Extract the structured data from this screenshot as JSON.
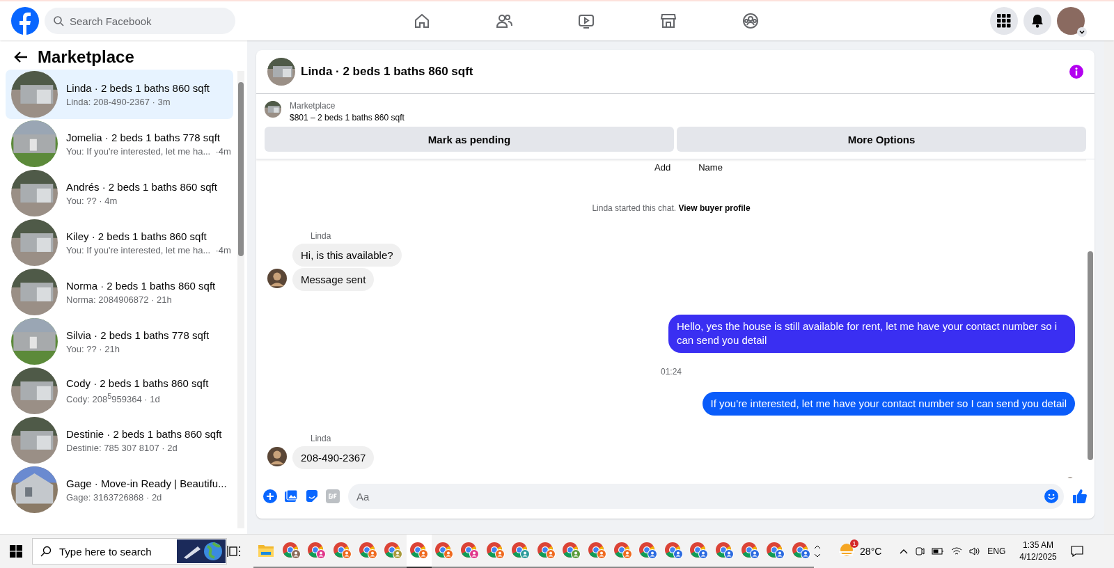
{
  "top_bar": {
    "search": {
      "placeholder": "Search Facebook"
    },
    "nav": [
      {
        "kind": "home"
      },
      {
        "kind": "friends"
      },
      {
        "kind": "video"
      },
      {
        "kind": "store"
      },
      {
        "kind": "groups"
      }
    ]
  },
  "sidebar": {
    "title": "Marketplace",
    "conversations": [
      {
        "title": "Linda · 2 beds 1 baths 860 sqft",
        "preview": "Linda: 208-490-2367 · 3m",
        "kind": "garage",
        "selected": true
      },
      {
        "title": "Jomelia · 2 beds 1 baths 778 sqft",
        "preview": "You: If you're interested, let me ha...  ·4m",
        "kind": "house",
        "selected": false
      },
      {
        "title": "Andrés · 2 beds 1 baths 860 sqft",
        "preview": "You: ?? · 4m",
        "kind": "garage",
        "selected": false
      },
      {
        "title": "Kiley · 2 beds 1 baths 860 sqft",
        "preview": "You: If you're interested, let me ha...  ·4m",
        "kind": "garage",
        "selected": false
      },
      {
        "title": "Norma · 2 beds 1 baths 860 sqft",
        "preview": "Norma: 2084906872 · 21h",
        "kind": "garage",
        "selected": false
      },
      {
        "title": "Silvia · 2 beds 1 baths 778 sqft",
        "preview": "You: ?? · 21h",
        "kind": "house",
        "selected": false
      },
      {
        "title": "Cody · 2 beds 1 baths 860 sqft",
        "preview": "Cody: 208$^{5}$959364 · 1d",
        "kind": "garage",
        "selected": false
      },
      {
        "title": "Destinie · 2 beds 1 baths 860 sqft",
        "preview": "Destinie: 785 307 8107 · 2d",
        "kind": "garage",
        "selected": false
      },
      {
        "title": "Gage · Move-in Ready | Beautifu...",
        "preview": "Gage: 3163726868 · 2d",
        "kind": "blue-house",
        "selected": false
      }
    ]
  },
  "chat": {
    "title": "Linda · 2 beds 1 baths 860 sqft",
    "listing": {
      "label": "Marketplace",
      "summary": "$801 – 2 beds 1 baths 860 sqft"
    },
    "actions": [
      "Mark as pending",
      "More Options"
    ],
    "messages": [
      {
        "kind": "columns",
        "items": [
          "Add",
          "Name"
        ]
      },
      {
        "kind": "notice",
        "text": "Linda started this chat.",
        "link": "View buyer profile"
      },
      {
        "kind": "sender",
        "text": "Linda"
      },
      {
        "kind": "incoming",
        "text": "Hi, is this available?",
        "avatar": false
      },
      {
        "kind": "incoming",
        "text": "Message sent",
        "avatar": true
      },
      {
        "kind": "outgoing",
        "text": "Hello, yes the house is still available for rent, let me have your contact number so i can send you detail",
        "color": "#3a2ff2"
      },
      {
        "kind": "time",
        "text": "01:24"
      },
      {
        "kind": "outgoing",
        "text": "If you're interested,  let me have your contact number so I can send you detail",
        "color": "#0a5cfa"
      },
      {
        "kind": "sender",
        "text": "Linda"
      },
      {
        "kind": "incoming",
        "text": "208-490-2367",
        "avatar": true
      },
      {
        "kind": "seen"
      }
    ],
    "composer": {
      "placeholder": "Aa"
    }
  },
  "taskbar": {
    "search": {
      "placeholder": "Type here to search"
    },
    "apps": [
      {
        "kind": "explorer",
        "selected": false
      },
      {
        "kind": "chrome",
        "color": "#8a6a58",
        "selected": false
      },
      {
        "kind": "chrome",
        "color": "#e0368a",
        "selected": false
      },
      {
        "kind": "chrome",
        "color": "#ef6a1f",
        "selected": false
      },
      {
        "kind": "chrome",
        "color": "#ef6a1f",
        "selected": false
      },
      {
        "kind": "chrome",
        "color": "#a89a3a",
        "selected": false
      },
      {
        "kind": "chrome",
        "color": "#ef6a1f",
        "selected": true
      },
      {
        "kind": "chrome",
        "color": "#ef6a1f",
        "selected": false
      },
      {
        "kind": "chrome",
        "color": "#e0368a",
        "selected": false
      },
      {
        "kind": "chrome",
        "color": "#ef6a1f",
        "selected": false
      },
      {
        "kind": "chrome",
        "color": "#2a9a9a",
        "selected": false
      },
      {
        "kind": "chrome",
        "color": "#ef6a1f",
        "selected": false
      },
      {
        "kind": "chrome",
        "color": "#5a9a3a",
        "selected": false
      },
      {
        "kind": "chrome",
        "color": "#ef6a1f",
        "selected": false
      },
      {
        "kind": "chrome",
        "color": "#ef6a1f",
        "selected": false
      },
      {
        "kind": "chrome",
        "color": "#2a6ae0",
        "selected": false
      },
      {
        "kind": "chrome",
        "color": "#2a6ae0",
        "selected": false
      },
      {
        "kind": "chrome",
        "color": "#2a6ae0",
        "selected": false
      },
      {
        "kind": "chrome",
        "color": "#2a6ae0",
        "selected": false
      },
      {
        "kind": "chrome",
        "color": "#2a6ae0",
        "selected": false
      },
      {
        "kind": "chrome",
        "color": "#2a6ae0",
        "selected": false
      },
      {
        "kind": "chrome",
        "color": "#2a6ae0",
        "selected": false
      }
    ],
    "weather": {
      "badge": "1",
      "temp": "28°C"
    },
    "language": "ENG",
    "time": "1:35 AM",
    "date": "4/12/2025"
  }
}
